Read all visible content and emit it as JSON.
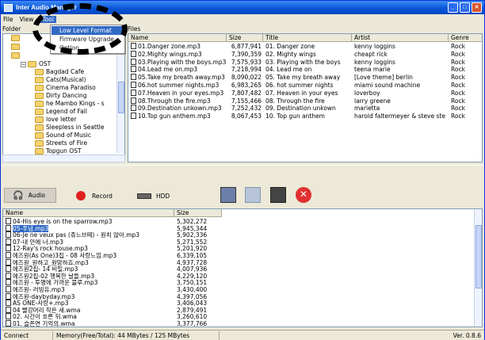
{
  "window": {
    "title": "Inter Audio Manager",
    "app_icon": "app-icon"
  },
  "menu": {
    "items": [
      "File",
      "View",
      "Tool"
    ],
    "active": "Tool"
  },
  "tool_menu": {
    "items": [
      "Low Level Format",
      "Firmware Upgrade",
      "Option"
    ],
    "selected": "Low Level Format"
  },
  "labels": {
    "folder": "Folder",
    "files": "Files"
  },
  "tree": {
    "items": [
      {
        "label": "OST",
        "expanded": true,
        "indent": 1
      },
      {
        "label": "Bagdad Cafe",
        "indent": 2
      },
      {
        "label": "Cats(Musical)",
        "indent": 2
      },
      {
        "label": "Cinema Paradiso",
        "indent": 2
      },
      {
        "label": "Dirty Dancing",
        "indent": 2
      },
      {
        "label": "he Mambo Kings - s",
        "indent": 2
      },
      {
        "label": "Legend of Fall",
        "indent": 2
      },
      {
        "label": "love letter",
        "indent": 2
      },
      {
        "label": "Sleepless in Seattle",
        "indent": 2
      },
      {
        "label": "Sound of Music",
        "indent": 2
      },
      {
        "label": "Streets of Fire",
        "indent": 2
      },
      {
        "label": "Topgun OST",
        "indent": 2
      }
    ]
  },
  "pc_files": {
    "columns": [
      "Name",
      "Size",
      "Title",
      "Artist",
      "Genre"
    ],
    "rows": [
      [
        "01.Danger zone.mp3",
        "6,877,941",
        "01. Danger zone",
        "kenny loggins",
        "Rock"
      ],
      [
        "02.Mighty wings.mp3",
        "7,390,359",
        "02. Mighty wings",
        "cheapt rick",
        "Rock"
      ],
      [
        "03.Playing with the boys.mp3",
        "7,575,933",
        "03. Playing with the boys",
        "kenny loggins",
        "Rock"
      ],
      [
        "04.Lead me on.mp3",
        "7,218,994",
        "04. Lead me on",
        "teena marie",
        "Rock"
      ],
      [
        "05.Take my breath away.mp3",
        "8,090,022",
        "05. Take my breath away",
        "[Love theme] berlin",
        "Rock"
      ],
      [
        "06.hot summer nights.mp3",
        "6,983,265",
        "06. hot summer nights",
        "miami sound machine",
        "Rock"
      ],
      [
        "07.Heaven in your eyes.mp3",
        "7,807,482",
        "07. Heaven in your eyes",
        "loverboy",
        "Rock"
      ],
      [
        "08.Through the fire.mp3",
        "7,155,466",
        "08. Through the fire",
        "larry greene",
        "Rock"
      ],
      [
        "09.Destination unkown.mp3",
        "7,252,432",
        "09. Destination unkown",
        "marietta",
        "Rock"
      ],
      [
        "10.Top gun anthem.mp3",
        "8,067,453",
        "10. Top gun anthem",
        "harold faltermeyer & steve ste",
        "Rock"
      ]
    ]
  },
  "modes": {
    "audio": "Audio",
    "record": "Record",
    "hdd": "HDD",
    "selected": "Audio"
  },
  "device_files": {
    "columns": [
      "Name",
      "Size"
    ],
    "selected_index": 1,
    "rows": [
      [
        "04-His eye is on the sparrow.mp3",
        "5,302,272"
      ],
      [
        "05-푸념.mp3",
        "5,945,344"
      ],
      [
        "06-Je ne veux pas (쥬느브떼) - 원치 않아.mp3",
        "5,902,336"
      ],
      [
        "07-내 안에 너.mp3",
        "5,271,552"
      ],
      [
        "12-Ray's rock house.mp3",
        "5,201,920"
      ],
      [
        "에즈원(As One)3집 - 08 사랑느낌.mp3",
        "6,339,105"
      ],
      [
        "에즈원_원하고_원망하죠.mp3",
        "4,937,728"
      ],
      [
        "에즈원2집- 14 비밀.mp3",
        "4,007,936"
      ],
      [
        "에즈원2집-02 행복한 날들.mp3",
        "4,229,120"
      ],
      [
        "에즈원 - 투명에 가까운 블루.mp3",
        "3,750,151"
      ],
      [
        "에즈원- 러빙유.mp3",
        "3,430,400"
      ],
      [
        "에즈원-daybyday.mp3",
        "4,397,056"
      ],
      [
        "AS ONE-사랑+.mp3",
        "3,406,043"
      ],
      [
        "04 빨강머리 작은 새.wma",
        "2,879,491"
      ],
      [
        "02. 시간이 흐른 뒤.wma",
        "3,260,610"
      ],
      [
        "01. 슬픈연 기억의.wma",
        "3,377,766"
      ]
    ]
  },
  "status": {
    "connect": "Connect",
    "memory": "Memory(Free/Total): 44 MBytes / 125 MBytes",
    "version": "Ver. 0.8.6"
  },
  "colors": {
    "titlebar": "#0a56d8",
    "selection": "#316ac5",
    "record": "#e02020",
    "delete": "#e03030"
  }
}
